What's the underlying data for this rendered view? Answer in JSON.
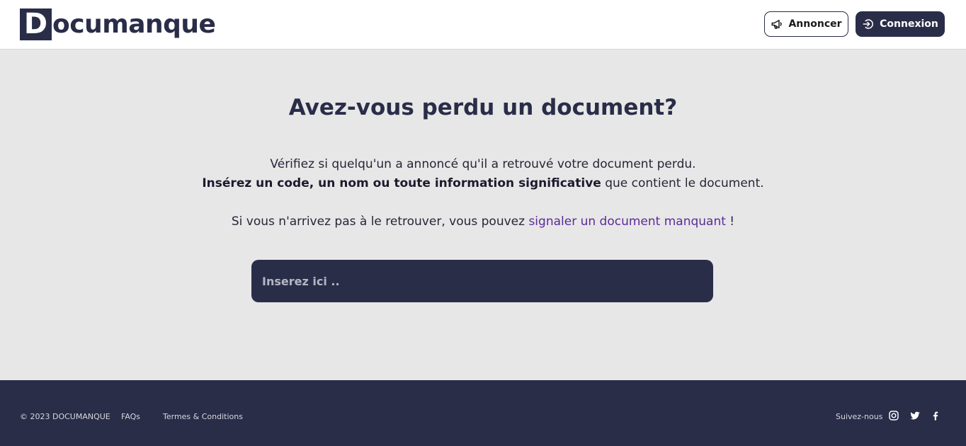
{
  "header": {
    "logo_initial": "D",
    "logo_rest": "ocumanque",
    "announce_label": "Annoncer",
    "login_label": "Connexion"
  },
  "main": {
    "title": "Avez-vous perdu un document?",
    "line1": "Vérifiez si quelqu'un a annoncé qu'il a retrouvé votre document perdu.",
    "line2_bold": "Insérez un code, un nom ou toute information significative",
    "line2_rest": " que contient le document.",
    "line3_prefix": "Si vous n'arrivez pas à le retrouver, vous pouvez ",
    "line3_link": "signaler un document manquant",
    "line3_suffix": " !",
    "search": {
      "placeholder": "Inserez ici ..",
      "value": ""
    }
  },
  "footer": {
    "copyright": "© 2023 DOCUMANQUE",
    "faqs": "FAQs",
    "terms": "Termes & Conditions",
    "follow": "Suivez-nous",
    "social_icons": [
      "instagram-icon",
      "twitter-icon",
      "facebook-icon"
    ]
  },
  "colors": {
    "navy": "#2a2d48",
    "background": "#e7e7e7",
    "link": "#5b2a9a"
  }
}
